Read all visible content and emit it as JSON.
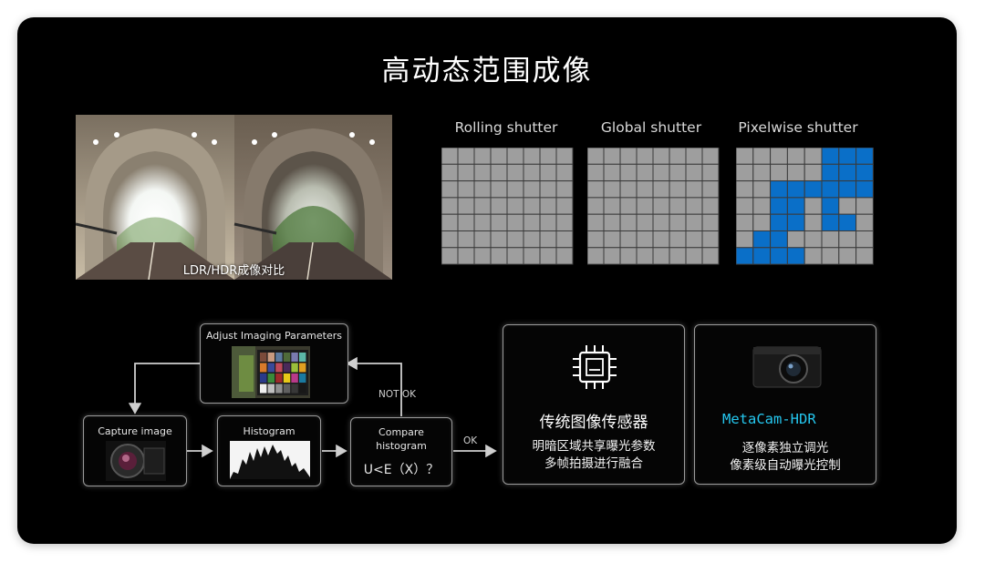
{
  "title": "高动态范围成像",
  "photo": {
    "caption": "LDR/HDR成像对比"
  },
  "shutters": [
    {
      "label": "Rolling shutter"
    },
    {
      "label": "Global shutter"
    },
    {
      "label": "Pixelwise shutter"
    }
  ],
  "flow": {
    "adjust": "Adjust Imaging Parameters",
    "capture": "Capture image",
    "histogram": "Histogram",
    "compare_line1": "Compare",
    "compare_line2": "histogram",
    "compare_formula": "U<E（X）？",
    "not_ok": "NOT OK",
    "ok": "OK"
  },
  "traditional": {
    "title": "传统图像传感器",
    "line1": "明暗区域共享曝光参数",
    "line2": "多帧拍摄进行融合"
  },
  "metacam": {
    "title": "MetaCam-HDR",
    "line1": "逐像素独立调光",
    "line2": "像素级自动曝光控制"
  },
  "colors": {
    "accent_blue": "#0a6fc8",
    "gray_cell": "#9e9e9e",
    "meta_cyan": "#25c8f0"
  }
}
